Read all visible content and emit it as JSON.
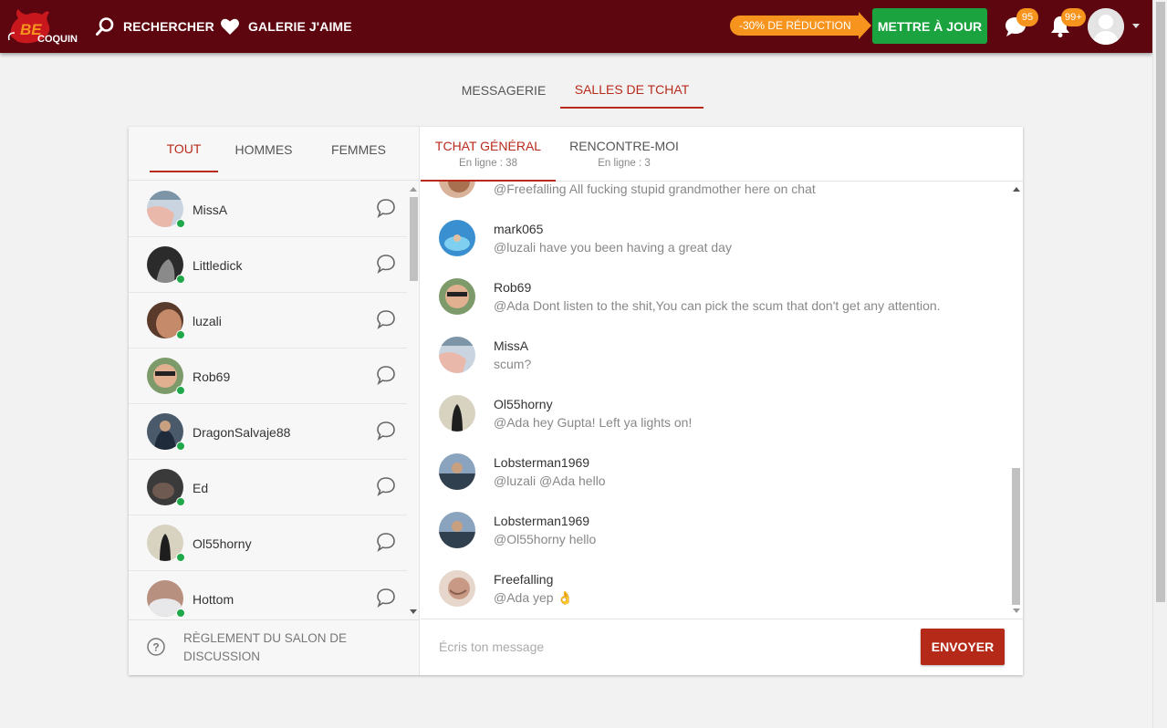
{
  "header": {
    "logo_text": "BE COQUIN",
    "search_label": "RECHERCHER",
    "gallery_label": "GALERIE J'AIME",
    "promo_label": "-30% DE RÉDUCTION",
    "upgrade_label": "METTRE À JOUR",
    "messages_badge": "95",
    "notifications_badge": "99+",
    "colors": {
      "bar": "#5e0610",
      "upgrade": "#1aa33e",
      "promo": "#f7941d"
    }
  },
  "top_tabs": [
    {
      "label": "MESSAGERIE",
      "active": false
    },
    {
      "label": "SALLES DE TCHAT",
      "active": true
    }
  ],
  "filter_tabs": [
    {
      "label": "TOUT",
      "active": true
    },
    {
      "label": "HOMMES",
      "active": false
    },
    {
      "label": "FEMMES",
      "active": false
    }
  ],
  "users": [
    {
      "name": "MissA"
    },
    {
      "name": "Littledick"
    },
    {
      "name": "luzali"
    },
    {
      "name": "Rob69"
    },
    {
      "name": "DragonSalvaje88"
    },
    {
      "name": "Ed"
    },
    {
      "name": "Ol55horny"
    },
    {
      "name": "Hottom"
    }
  ],
  "rules_label": "RÈGLEMENT DU SALON DE DISCUSSION",
  "chat_tabs": [
    {
      "label": "TCHAT GÉNÉRAL",
      "sub": "En ligne : 38",
      "active": true
    },
    {
      "label": "RENCONTRE-MOI",
      "sub": "En ligne : 3",
      "active": false
    }
  ],
  "partial_message": "@Freefalling All fucking stupid grandmother here on chat",
  "messages": [
    {
      "user": "mark065",
      "text": "@luzali have you been having a great day"
    },
    {
      "user": "Rob69",
      "text": "@Ada Dont listen to the shit,You can pick the scum that don't get any attention."
    },
    {
      "user": "MissA",
      "text": "scum?"
    },
    {
      "user": "Ol55horny",
      "text": "@Ada hey Gupta! Left ya lights on!"
    },
    {
      "user": "Lobsterman1969",
      "text": "@luzali @Ada hello"
    },
    {
      "user": "Lobsterman1969",
      "text": "@Ol55horny hello"
    },
    {
      "user": "Freefalling",
      "text": "@Ada yep 👌"
    }
  ],
  "composer": {
    "placeholder": "Écris ton message",
    "send_label": "ENVOYER"
  }
}
